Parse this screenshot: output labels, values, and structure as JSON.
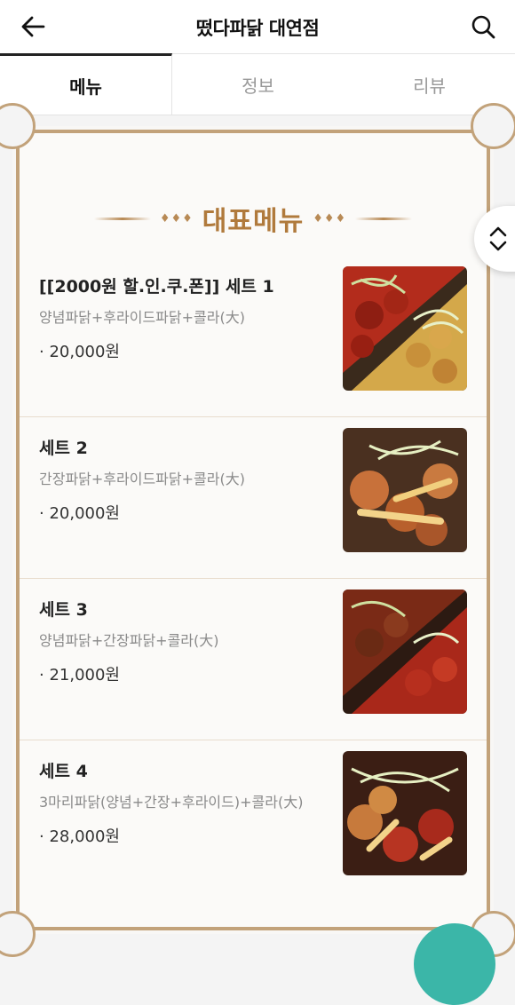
{
  "header": {
    "title": "떴다파닭 대연점",
    "back_icon": "arrow-left-icon",
    "search_icon": "search-icon"
  },
  "tabs": [
    {
      "label": "메뉴",
      "active": true
    },
    {
      "label": "정보",
      "active": false
    },
    {
      "label": "리뷰",
      "active": false
    }
  ],
  "section": {
    "title": "대표메뉴",
    "accent_color": "#b07a3c",
    "frame_color": "#c2a27a"
  },
  "items": [
    {
      "name": "[[2000원 할.인.쿠.폰]]  세트 1",
      "desc": "양념파닭+후라이드파닭+콜라(大)",
      "price": "· 20,000원",
      "image": "fried-chicken-combo-image"
    },
    {
      "name": "세트 2",
      "desc": "간장파닭+후라이드파닭+콜라(大)",
      "price": "· 20,000원",
      "image": "soy-chicken-fries-image"
    },
    {
      "name": "세트 3",
      "desc": "양념파닭+간장파닭+콜라(大)",
      "price": "· 21,000원",
      "image": "seasoned-soy-chicken-image"
    },
    {
      "name": "세트 4",
      "desc": "3마리파닭(양념+간장+후라이드)+콜라(大)",
      "price": "· 28,000원",
      "image": "three-chicken-set-image"
    }
  ],
  "scroll_toggle_icon": "chevron-up-down-icon",
  "fab_color": "#3bb6a8"
}
